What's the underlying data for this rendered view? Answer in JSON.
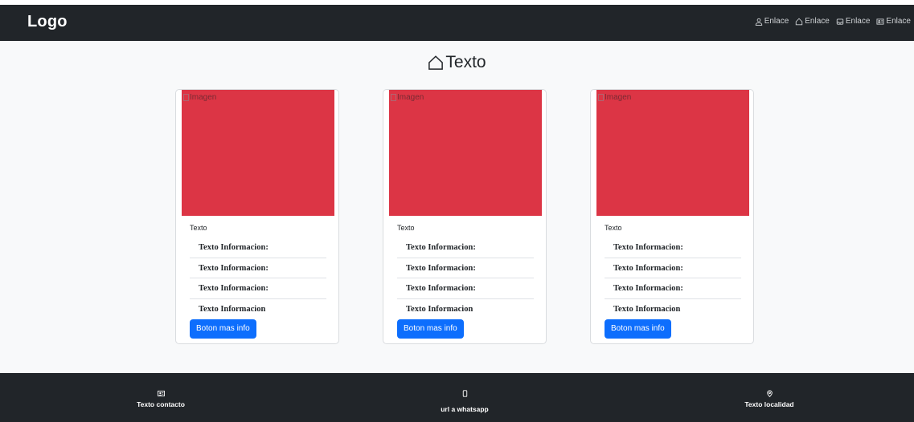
{
  "navbar": {
    "logo": "Logo",
    "links": [
      {
        "label": "Enlace",
        "icon": "person-icon"
      },
      {
        "label": "Enlace",
        "icon": "house-icon"
      },
      {
        "label": "Enlace",
        "icon": "inbox-icon"
      },
      {
        "label": "Enlace",
        "icon": "contact-card-icon"
      }
    ]
  },
  "page": {
    "title": "Texto",
    "title_icon": "house-icon"
  },
  "cards": [
    {
      "image_alt": "Imagen",
      "text": "Texto",
      "info": [
        "Texto Informacion:",
        "Texto Informacion:",
        "Texto Informacion:",
        "Texto Informacion"
      ],
      "button": "Boton mas info"
    },
    {
      "image_alt": "Imagen",
      "text": "Texto",
      "info": [
        "Texto Informacion:",
        "Texto Informacion:",
        "Texto Informacion:",
        "Texto Informacion"
      ],
      "button": "Boton mas info"
    },
    {
      "image_alt": "Imagen",
      "text": "Texto",
      "info": [
        "Texto Informacion:",
        "Texto Informacion:",
        "Texto Informacion:",
        "Texto Informacion"
      ],
      "button": "Boton mas info"
    }
  ],
  "footer": {
    "contact": {
      "label": "Texto contacto",
      "icon": "contact-card-icon"
    },
    "whatsapp": {
      "label": "url a whatsapp",
      "icon": "phone-icon"
    },
    "location": {
      "label": "Texto localidad",
      "icon": "geo-pin-icon"
    }
  },
  "colors": {
    "navbar_bg": "#212529",
    "image_placeholder": "#dc3545",
    "button": "#0d6efd",
    "page_bg": "#f8f9fa"
  }
}
